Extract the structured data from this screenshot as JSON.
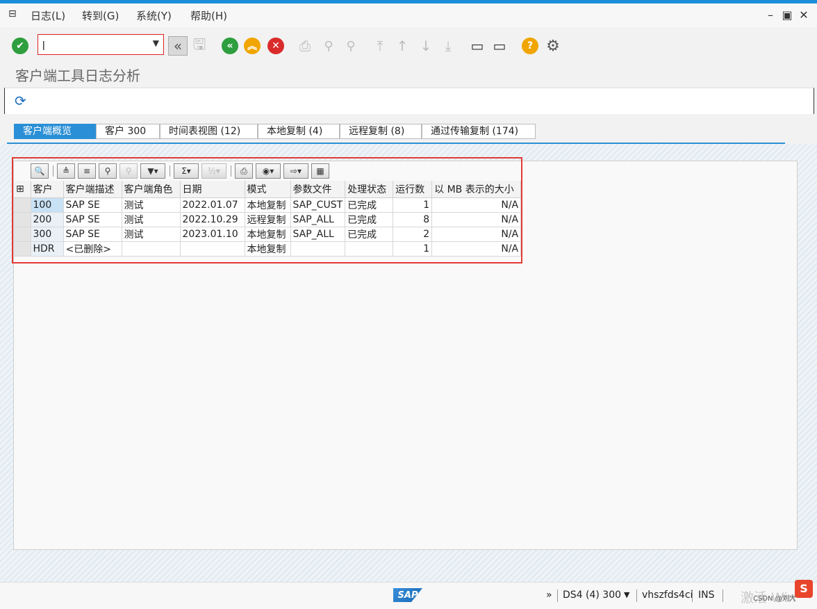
{
  "menu": {
    "items": [
      "日志(L)",
      "转到(G)",
      "系统(Y)",
      "帮助(H)"
    ]
  },
  "toolbar": {
    "command_value": "|",
    "icons": [
      "enter-check",
      "save",
      "back",
      "exit",
      "cancel",
      "print",
      "find",
      "find-next",
      "first-page",
      "previous-page",
      "next-page",
      "last-page",
      "create-session",
      "shortcut",
      "help",
      "settings"
    ]
  },
  "page": {
    "title": "客户端工具日志分析"
  },
  "tabs": [
    {
      "label": "客户端概览",
      "active": true
    },
    {
      "label": "客户 300",
      "active": false
    },
    {
      "label": "时间表视图 (12)",
      "active": false
    },
    {
      "label": "本地复制 (4)",
      "active": false
    },
    {
      "label": "远程复制 (8)",
      "active": false
    },
    {
      "label": "通过传输复制 (174)",
      "active": false
    }
  ],
  "grid": {
    "columns": [
      "客户",
      "客户端描述",
      "客户端角色",
      "日期",
      "模式",
      "参数文件",
      "处理状态",
      "运行数",
      "以 MB 表示的大小"
    ],
    "rows": [
      [
        "100",
        "SAP SE",
        "测试",
        "2022.01.07",
        "本地复制",
        "SAP_CUST",
        "已完成",
        "1",
        "N/A"
      ],
      [
        "200",
        "SAP SE",
        "测试",
        "2022.10.29",
        "远程复制",
        "SAP_ALL",
        "已完成",
        "8",
        "N/A"
      ],
      [
        "300",
        "SAP SE",
        "测试",
        "2023.01.10",
        "本地复制",
        "SAP_ALL",
        "已完成",
        "2",
        "N/A"
      ],
      [
        "HDR",
        "<已删除>",
        "",
        "",
        "本地复制",
        "",
        "",
        "1",
        "N/A"
      ]
    ]
  },
  "status": {
    "logo": "SAP",
    "expand": "»",
    "system": "DS4 (4) 300",
    "server": "vhszfds4ci",
    "mode": "INS",
    "watermark": "激活 Win",
    "credit": "CSDN @刘大"
  },
  "colors": {
    "accent": "#2a8fd6",
    "highlight_border": "#e53935",
    "ok_green": "#2e9e3e",
    "back_green": "#2e9e3e",
    "exit_orange": "#f0a500",
    "cancel_red": "#d92b2b",
    "help_yellow": "#f0a500"
  }
}
